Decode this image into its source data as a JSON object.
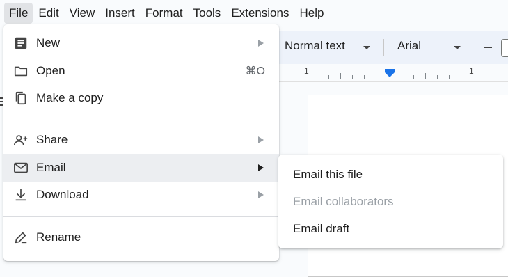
{
  "menubar": {
    "items": [
      "File",
      "Edit",
      "View",
      "Insert",
      "Format",
      "Tools",
      "Extensions",
      "Help"
    ]
  },
  "toolbar": {
    "paragraph_style": "Normal text",
    "font": "Arial"
  },
  "ruler": {
    "labels": [
      "1",
      "1"
    ]
  },
  "file_menu": {
    "new_label": "New",
    "open_label": "Open",
    "open_shortcut": "⌘O",
    "copy_label": "Make a copy",
    "share_label": "Share",
    "email_label": "Email",
    "download_label": "Download",
    "rename_label": "Rename"
  },
  "email_submenu": {
    "email_file": "Email this file",
    "email_collaborators": "Email collaborators",
    "email_draft": "Email draft"
  }
}
